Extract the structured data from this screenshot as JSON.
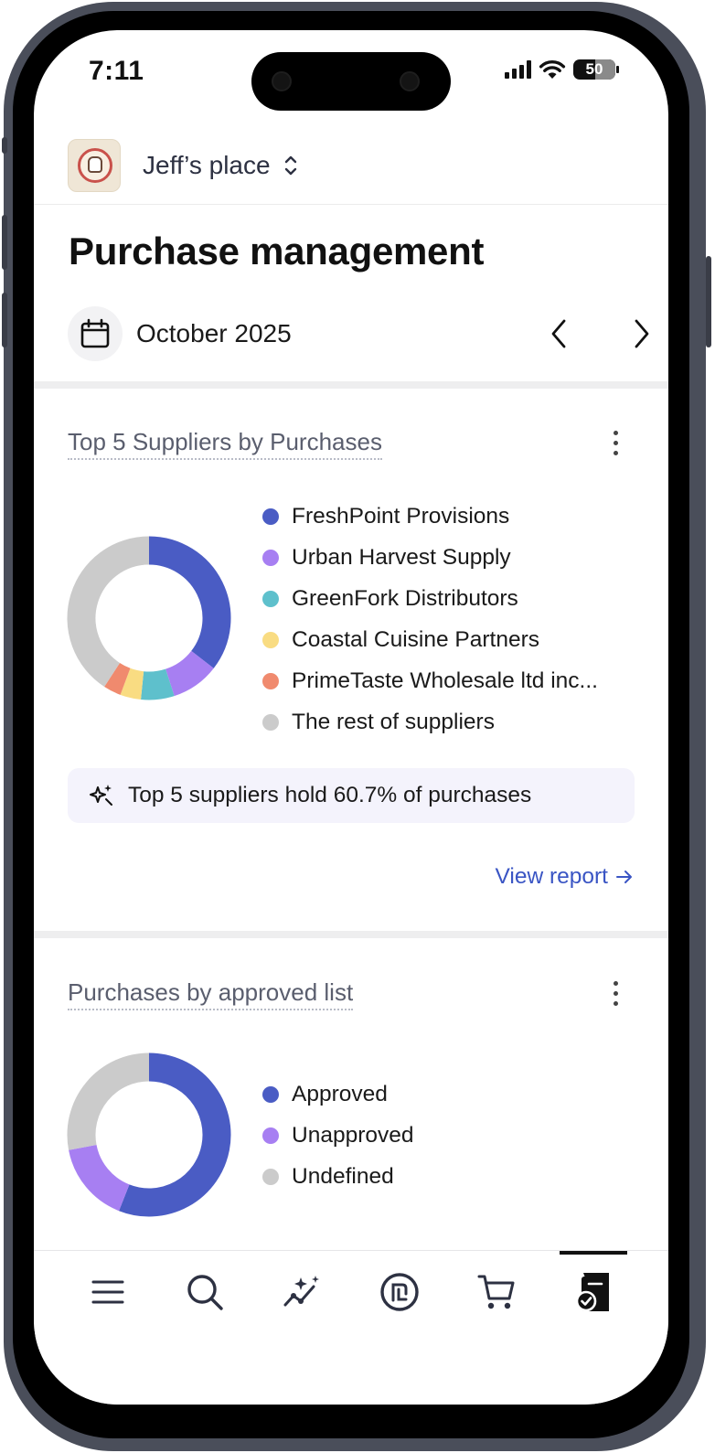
{
  "status": {
    "time": "7:11",
    "battery": "50"
  },
  "venue": {
    "name": "Jeff’s place",
    "logo_icon": "restaurant-logo",
    "switch_icon": "chevron-up-down-icon"
  },
  "page": {
    "title": "Purchase management"
  },
  "period": {
    "label": "October 2025",
    "icon": "calendar-icon",
    "prev_icon": "chevron-left-icon",
    "next_icon": "chevron-right-icon"
  },
  "suppliers_card": {
    "title": "Top 5 Suppliers by Purchases",
    "legend": [
      {
        "label": "FreshPoint Provisions",
        "color": "#4a5cc4"
      },
      {
        "label": "Urban Harvest Supply",
        "color": "#a77ff2"
      },
      {
        "label": "GreenFork Distributors",
        "color": "#5ec0cc"
      },
      {
        "label": "Coastal Cuisine Partners",
        "color": "#f9dc82"
      },
      {
        "label": "PrimeTaste Wholesale ltd inc...",
        "color": "#f08a6e"
      },
      {
        "label": "The rest of suppliers",
        "color": "#cbcbcb"
      }
    ],
    "insight": "Top 5 suppliers hold 60.7% of purchases",
    "insight_icon": "sparkles-icon",
    "view_report": "View report",
    "view_report_icon": "arrow-right-icon"
  },
  "approved_card": {
    "title": "Purchases by approved list",
    "legend": [
      {
        "label": "Approved",
        "color": "#4a5cc4"
      },
      {
        "label": "Unapproved",
        "color": "#a77ff2"
      },
      {
        "label": "Undefined",
        "color": "#cbcbcb"
      }
    ]
  },
  "chart_data": [
    {
      "type": "pie",
      "title": "Top 5 Suppliers by Purchases",
      "categories": [
        "FreshPoint Provisions",
        "Urban Harvest Supply",
        "GreenFork Distributors",
        "Coastal Cuisine Partners",
        "PrimeTaste Wholesale ltd inc...",
        "The rest of suppliers"
      ],
      "values": [
        35.5,
        9.5,
        6.6,
        4.1,
        3.5,
        40.8
      ],
      "colors": [
        "#4a5cc4",
        "#a77ff2",
        "#5ec0cc",
        "#f9dc82",
        "#f08a6e",
        "#cbcbcb"
      ]
    },
    {
      "type": "pie",
      "title": "Purchases by approved list",
      "categories": [
        "Approved",
        "Unapproved",
        "Undefined"
      ],
      "values": [
        56,
        16,
        28
      ],
      "colors": [
        "#4a5cc4",
        "#a77ff2",
        "#cbcbcb"
      ]
    }
  ],
  "tabbar": {
    "items": [
      {
        "icon": "menu-icon"
      },
      {
        "icon": "search-icon"
      },
      {
        "icon": "insights-icon"
      },
      {
        "icon": "currency-icon"
      },
      {
        "icon": "cart-icon"
      },
      {
        "icon": "purchase-document-icon",
        "active": true
      }
    ]
  }
}
